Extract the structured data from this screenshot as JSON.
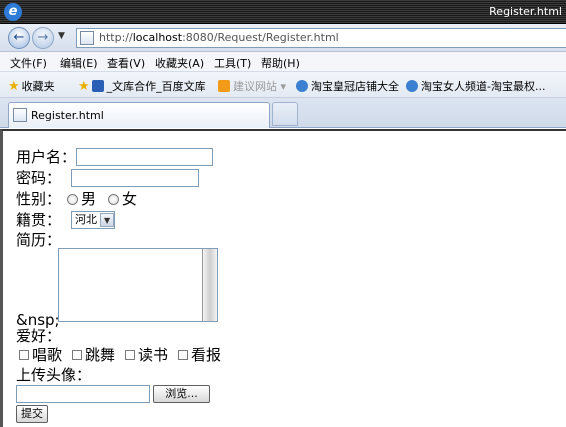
{
  "window": {
    "title": "Register.html"
  },
  "address_bar": {
    "url_prefix": "http://",
    "url_host": "localhost",
    "url_rest": ":8080/Request/Register.html"
  },
  "menu": [
    "文件(F)",
    "编辑(E)",
    "查看(V)",
    "收藏夹(A)",
    "工具(T)",
    "帮助(H)"
  ],
  "favorites": {
    "label": "收藏夹",
    "items": [
      "_文库合作_百度文库",
      "建议网站 ▾",
      "淘宝皇冠店铺大全",
      "淘宝女人频道-淘宝最权..."
    ]
  },
  "tab": {
    "label": "Register.html"
  },
  "form": {
    "username_label": "用户名：",
    "password_label": "密码：",
    "gender_label": "性别：",
    "gender_options": [
      "男",
      "女"
    ],
    "hometown_label": "籍贯：",
    "hometown_selected": "河北",
    "resume_label": "简历：",
    "stray_text": "&nsp;",
    "hobbies_label": "爱好：",
    "hobbies": [
      "唱歌",
      "跳舞",
      "读书",
      "看报"
    ],
    "avatar_label": "上传头像：",
    "browse_label": "浏览...",
    "submit_label": "提交"
  },
  "icons": [
    "ie-logo-icon",
    "back-arrow-icon",
    "forward-arrow-icon",
    "page-icon",
    "star-icon"
  ]
}
